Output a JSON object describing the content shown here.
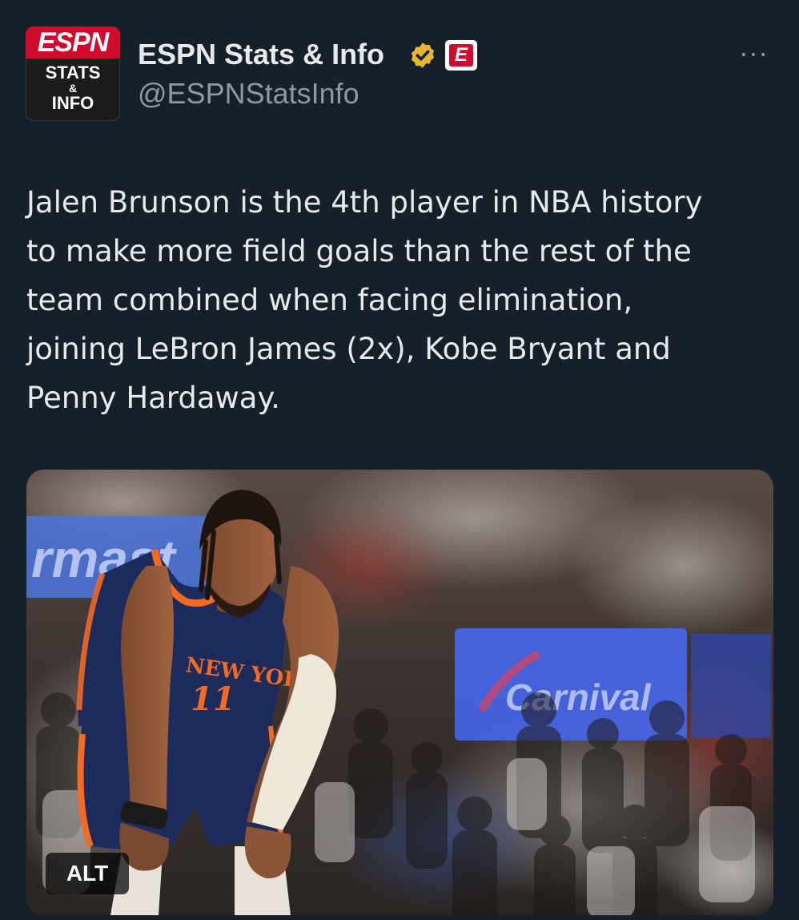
{
  "account": {
    "avatar": {
      "logo": "ESPN",
      "line1": "STATS",
      "line2": "&",
      "line3": "INFO"
    },
    "display_name": "ESPN Stats & Info",
    "handle": "@ESPNStatsInfo",
    "affiliate_badge_letter": "E",
    "verified_color": "#e8b730"
  },
  "more_label": "···",
  "tweet": {
    "lines": [
      "Jalen Brunson is the 4th player in NBA history",
      "to make more field goals than the rest of the",
      "team combined when facing elimination,",
      "joining LeBron James (2x), Kobe Bryant and",
      "Penny Hardaway."
    ]
  },
  "media": {
    "banner_left_text": "rmast",
    "banner_right_text": "Carnival",
    "jersey_text": "NEW YORK",
    "jersey_number": "11",
    "alt_label": "ALT"
  },
  "colors": {
    "background": "#15202b",
    "text": "#e7e9ea",
    "secondary_text": "#8b98a5",
    "espn_red": "#cf0a2c",
    "knicks_blue": "#1d2a5c",
    "knicks_orange": "#f26a24"
  }
}
